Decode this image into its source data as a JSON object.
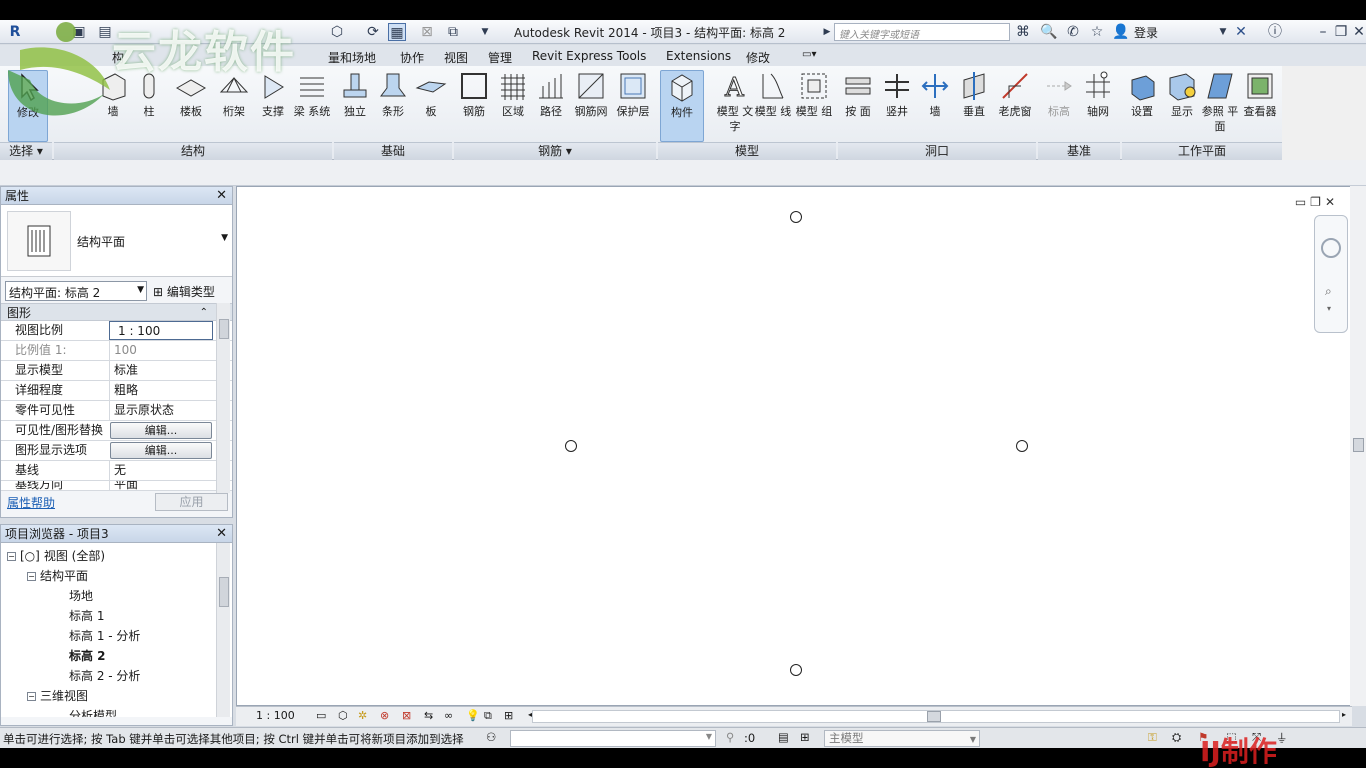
{
  "window": {
    "title": "Autodesk Revit 2014 -     项目3 - 结构平面: 标高 2",
    "search_placeholder": "键入关键字或短语",
    "login": "登录"
  },
  "watermark": {
    "logo_text": "云龙软件",
    "bottom_text": "IJ制作"
  },
  "tabs": [
    "构",
    "量和场地",
    "协作",
    "视图",
    "管理",
    "Revit Express Tools",
    "Extensions",
    "修改"
  ],
  "ribbon": {
    "buttons": {
      "modify": "修改",
      "wall": "墙",
      "column": "柱",
      "floor": "楼板",
      "truss": "桁架",
      "brace": "支撑",
      "beam_system": "梁 系统",
      "isolated": "独立",
      "strip": "条形",
      "slab": "板",
      "rebar": "钢筋",
      "area": "区域",
      "path": "路径",
      "fabric": "钢筋网",
      "cover": "保护层",
      "component": "构件",
      "model_text": "模型 文字",
      "model_line": "模型 线",
      "model_group": "模型 组",
      "by_face": "按 面",
      "shaft": "竖井",
      "wall_opening": "墙",
      "vertical": "垂直",
      "dormer": "老虎窗",
      "level": "标高",
      "grid": "轴网",
      "set": "设置",
      "show": "显示",
      "ref_plane": "参照 平面",
      "viewer": "查看器"
    },
    "groups": {
      "select": "选择 ▾",
      "structure": "结构",
      "foundation": "基础",
      "reinforcement": "钢筋 ▾",
      "model": "模型",
      "opening": "洞口",
      "datum": "基准",
      "work_plane": "工作平面"
    }
  },
  "properties": {
    "header": "属性",
    "type_name": "结构平面",
    "selector": "结构平面: 标高 2",
    "edit_type": "编辑类型",
    "section": "图形",
    "rows": [
      {
        "k": "视图比例",
        "v": "1 : 100"
      },
      {
        "k": "比例值 1:",
        "v": "100"
      },
      {
        "k": "显示模型",
        "v": "标准"
      },
      {
        "k": "详细程度",
        "v": "粗略"
      },
      {
        "k": "零件可见性",
        "v": "显示原状态"
      },
      {
        "k": "可见性/图形替换",
        "v": "编辑..."
      },
      {
        "k": "图形显示选项",
        "v": "编辑..."
      },
      {
        "k": "基线",
        "v": "无"
      },
      {
        "k": "基线方向",
        "v": "平面"
      }
    ],
    "help": "属性帮助",
    "apply": "应用"
  },
  "browser": {
    "header": "项目浏览器 - 项目3",
    "nodes": [
      {
        "label": "视图 (全部)"
      },
      {
        "label": "结构平面"
      },
      {
        "label": "场地"
      },
      {
        "label": "标高 1"
      },
      {
        "label": "标高 1 - 分析"
      },
      {
        "label": "标高 2"
      },
      {
        "label": "标高 2 - 分析"
      },
      {
        "label": "三维视图"
      },
      {
        "label": "分析模型"
      }
    ]
  },
  "viewbar": {
    "scale": "1 : 100"
  },
  "status": {
    "message": "单击可进行选择; 按 Tab 键并单击可选择其他项目; 按 Ctrl 键并单击可将新项目添加到选择",
    "zero": ":0",
    "model": "主模型"
  }
}
